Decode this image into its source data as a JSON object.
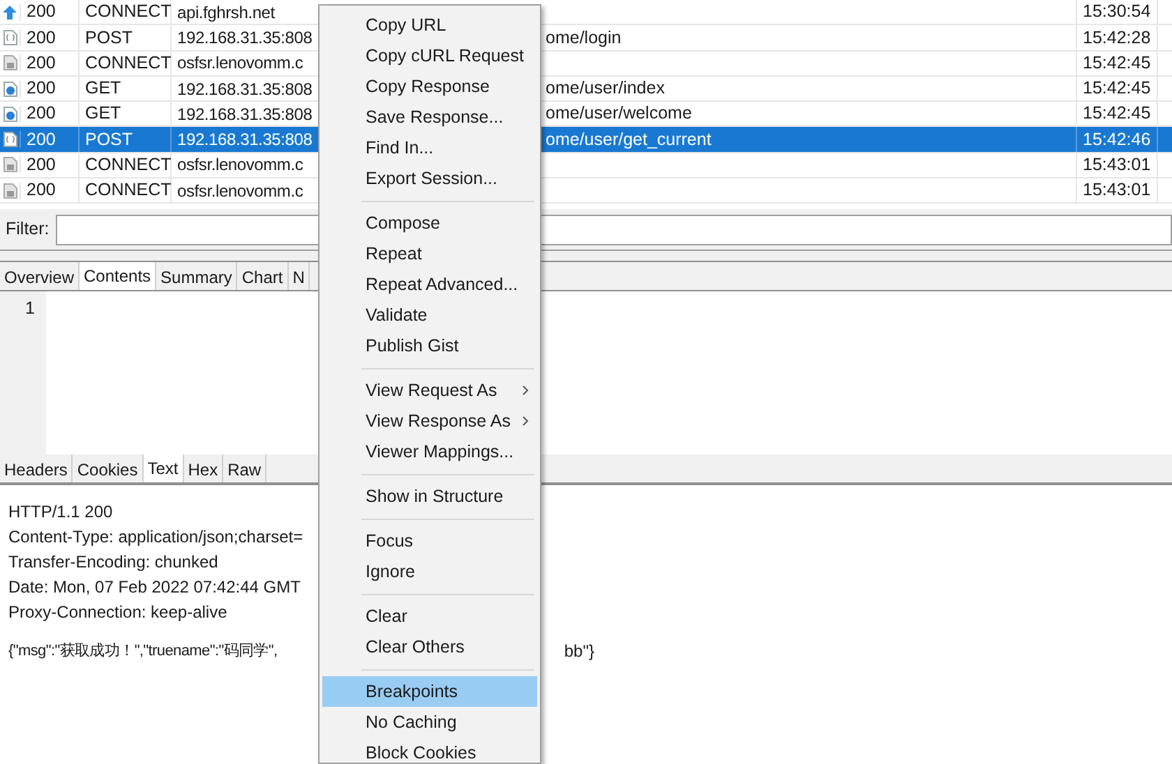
{
  "sessions": {
    "rows": [
      {
        "kind": "upload",
        "status": "200",
        "method": "CONNECT",
        "host": "api.fghrsh.net",
        "path": "",
        "time": "15:30:54",
        "selected": false
      },
      {
        "kind": "json",
        "status": "200",
        "method": "POST",
        "host": "192.168.31.35:808",
        "path": "ome/login",
        "time": "15:42:28",
        "selected": false
      },
      {
        "kind": "lock",
        "status": "200",
        "method": "CONNECT",
        "host": "osfsr.lenovomm.c",
        "path": "",
        "time": "15:42:45",
        "selected": false
      },
      {
        "kind": "web",
        "status": "200",
        "method": "GET",
        "host": "192.168.31.35:808",
        "path": "ome/user/index",
        "time": "15:42:45",
        "selected": false
      },
      {
        "kind": "web",
        "status": "200",
        "method": "GET",
        "host": "192.168.31.35:808",
        "path": "ome/user/welcome",
        "time": "15:42:45",
        "selected": false
      },
      {
        "kind": "json",
        "status": "200",
        "method": "POST",
        "host": "192.168.31.35:808",
        "path": "ome/user/get_current",
        "time": "15:42:46",
        "selected": true
      },
      {
        "kind": "lock",
        "status": "200",
        "method": "CONNECT",
        "host": "osfsr.lenovomm.c",
        "path": "",
        "time": "15:43:01",
        "selected": false
      },
      {
        "kind": "lock",
        "status": "200",
        "method": "CONNECT",
        "host": "osfsr.lenovomm.c",
        "path": "",
        "time": "15:43:01",
        "selected": false
      }
    ]
  },
  "filter": {
    "label": "Filter:"
  },
  "view_tabs": [
    {
      "label": "Overview",
      "selected": false
    },
    {
      "label": "Contents",
      "selected": true
    },
    {
      "label": "Summary",
      "selected": false
    },
    {
      "label": "Chart",
      "selected": false
    },
    {
      "label": "N",
      "selected": false
    }
  ],
  "request_body": {
    "line_numbers": [
      "1"
    ]
  },
  "response_tabs": [
    {
      "label": "Headers",
      "selected": false
    },
    {
      "label": "Cookies",
      "selected": false
    },
    {
      "label": "Text",
      "selected": true
    },
    {
      "label": "Hex",
      "selected": false
    },
    {
      "label": "Raw",
      "selected": false
    }
  ],
  "response_text": {
    "lines": [
      "HTTP/1.1 200",
      "Content-Type: application/json;charset=",
      "Transfer-Encoding: chunked",
      "Date: Mon, 07 Feb 2022 07:42:44 GMT",
      "Proxy-Connection: keep-alive"
    ],
    "body": "{\"msg\":\"获取成功！\",\"truename\":\"码同学\",",
    "body_tail": "bb\"}"
  },
  "context_menu": {
    "groups": [
      [
        {
          "label": "Copy URL",
          "submenu": false,
          "highlighted": false
        },
        {
          "label": "Copy cURL Request",
          "submenu": false,
          "highlighted": false
        },
        {
          "label": "Copy Response",
          "submenu": false,
          "highlighted": false
        },
        {
          "label": "Save Response...",
          "submenu": false,
          "highlighted": false
        },
        {
          "label": "Find In...",
          "submenu": false,
          "highlighted": false
        },
        {
          "label": "Export Session...",
          "submenu": false,
          "highlighted": false
        }
      ],
      [
        {
          "label": "Compose",
          "submenu": false,
          "highlighted": false
        },
        {
          "label": "Repeat",
          "submenu": false,
          "highlighted": false
        },
        {
          "label": "Repeat Advanced...",
          "submenu": false,
          "highlighted": false
        },
        {
          "label": "Validate",
          "submenu": false,
          "highlighted": false
        },
        {
          "label": "Publish Gist",
          "submenu": false,
          "highlighted": false
        }
      ],
      [
        {
          "label": "View Request As",
          "submenu": true,
          "highlighted": false
        },
        {
          "label": "View Response As",
          "submenu": true,
          "highlighted": false
        },
        {
          "label": "Viewer Mappings...",
          "submenu": false,
          "highlighted": false
        }
      ],
      [
        {
          "label": "Show in Structure",
          "submenu": false,
          "highlighted": false
        }
      ],
      [
        {
          "label": "Focus",
          "submenu": false,
          "highlighted": false
        },
        {
          "label": "Ignore",
          "submenu": false,
          "highlighted": false
        }
      ],
      [
        {
          "label": "Clear",
          "submenu": false,
          "highlighted": false
        },
        {
          "label": "Clear Others",
          "submenu": false,
          "highlighted": false
        }
      ],
      [
        {
          "label": "Breakpoints",
          "submenu": false,
          "highlighted": true
        },
        {
          "label": "No Caching",
          "submenu": false,
          "highlighted": false
        },
        {
          "label": "Block Cookies",
          "submenu": false,
          "highlighted": false
        }
      ]
    ]
  }
}
